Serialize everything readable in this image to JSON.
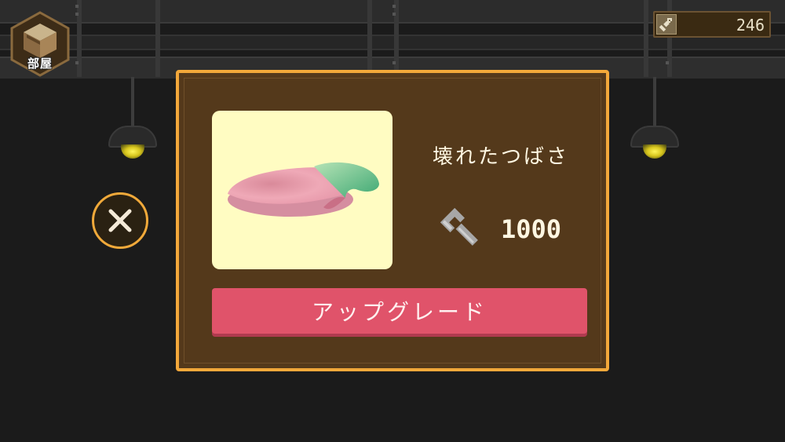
{
  "hud": {
    "room_button_label": "部屋",
    "currency_icon": "wrench-icon",
    "currency_amount": "246"
  },
  "modal": {
    "item_name": "壊れたつばさ",
    "item_image": "broken-wing-image",
    "cost_icon": "wrench-icon",
    "cost_amount": "1000",
    "upgrade_label": "アップグレード",
    "close_icon": "close-icon"
  },
  "colors": {
    "modal_bg": "#54391b",
    "modal_border": "#f3a83a",
    "item_bg": "#fffcc2",
    "upgrade_button": "#e0536a"
  }
}
